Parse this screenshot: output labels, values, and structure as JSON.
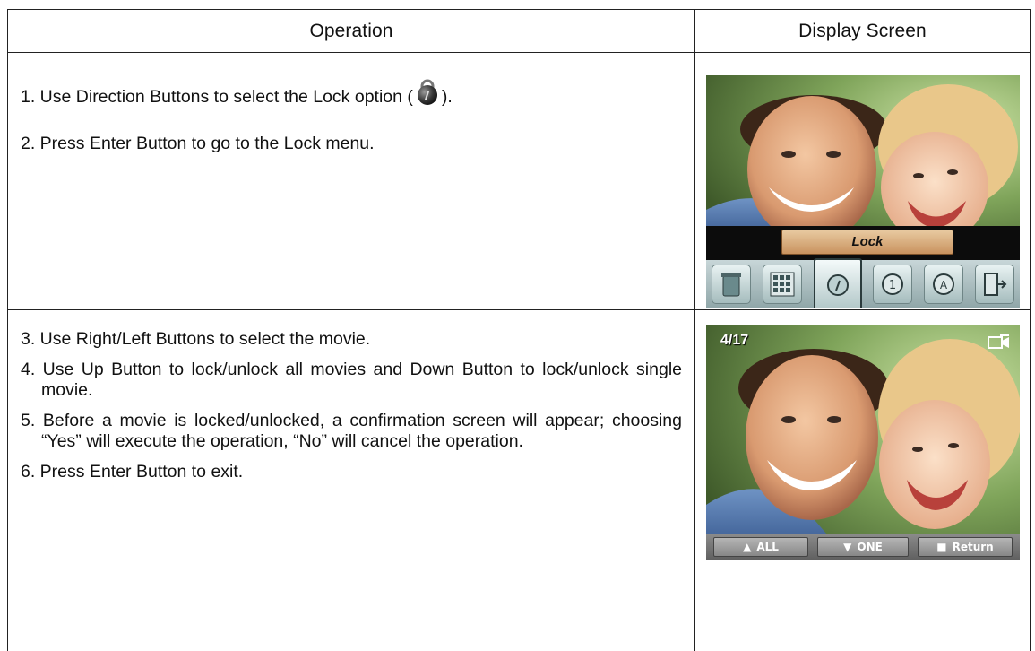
{
  "table": {
    "headers": {
      "operation": "Operation",
      "display": "Display Screen"
    },
    "rows": [
      {
        "steps": [
          {
            "before": "1. Use Direction Buttons to select the Lock option (",
            "after": ")."
          },
          {
            "text": "2. Press Enter Button to go to the Lock menu."
          }
        ],
        "screen": {
          "menu_label": "Lock",
          "icons": [
            "trash-icon",
            "thumbnail-icon",
            "lock-icon",
            "protect-icon",
            "slideshow-icon",
            "exit-icon"
          ],
          "selected_icon": "lock-icon"
        }
      },
      {
        "steps": [
          "3. Use Right/Left Buttons to select the movie.",
          "4. Use Up Button to lock/unlock all movies and Down Button to lock/unlock single movie.",
          "5. Before a movie is locked/unlocked, a confirmation screen will appear; choosing “Yes” will execute the operation, “No” will cancel the operation.",
          "6. Press Enter Button to exit."
        ],
        "screen": {
          "counter": "4/17",
          "buttons": [
            {
              "glyph": "▲",
              "label": "ALL"
            },
            {
              "glyph": "▼",
              "label": "ONE"
            },
            {
              "glyph": "■",
              "label": "Return"
            }
          ]
        }
      }
    ]
  }
}
